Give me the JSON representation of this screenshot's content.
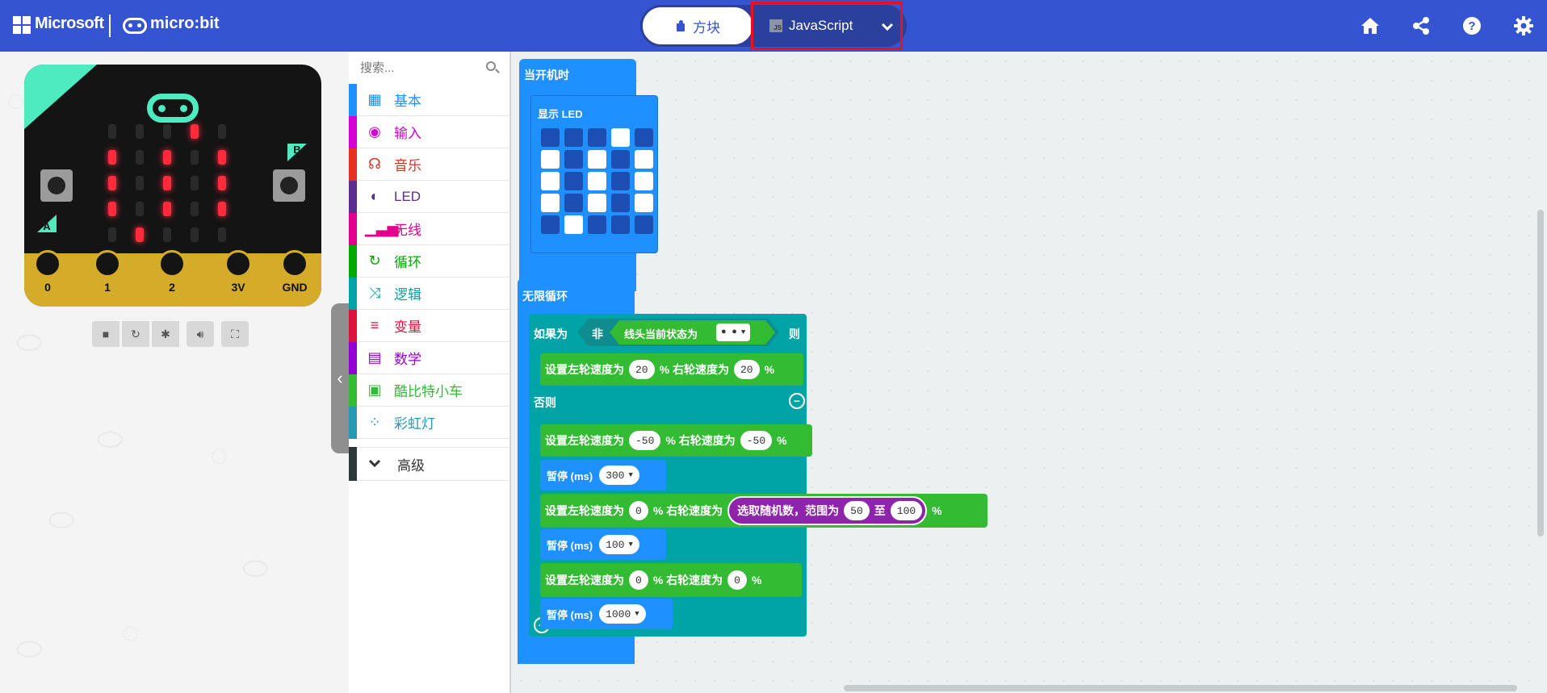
{
  "header": {
    "brand_microsoft": "Microsoft",
    "brand_microbit": "micro:bit",
    "mode_blocks_label": "方块",
    "mode_js_label": "JavaScript",
    "js_badge": "JS",
    "icons": [
      "home-icon",
      "share-icon",
      "help-icon",
      "settings-icon"
    ],
    "accent_color": "#3454d1"
  },
  "simulator": {
    "pins": [
      "0",
      "1",
      "2",
      "3V",
      "GND"
    ],
    "button_a": "A",
    "button_b": "B",
    "controls": [
      "stop-icon",
      "restart-icon",
      "debug-icon",
      "mute-icon",
      "fullscreen-icon"
    ]
  },
  "toolbox": {
    "search_placeholder": "搜索...",
    "categories": [
      {
        "label": "基本",
        "color": "#1e90ff",
        "icon": "grid-icon"
      },
      {
        "label": "输入",
        "color": "#d400d4",
        "icon": "target-icon"
      },
      {
        "label": "音乐",
        "color": "#e63022",
        "icon": "headphones-icon"
      },
      {
        "label": "LED",
        "color": "#5c2d91",
        "icon": "toggle-icon"
      },
      {
        "label": "无线",
        "color": "#e3008c",
        "icon": "signal-icon"
      },
      {
        "label": "循环",
        "color": "#00aa00",
        "icon": "refresh-icon"
      },
      {
        "label": "逻辑",
        "color": "#00a4a6",
        "icon": "shuffle-icon"
      },
      {
        "label": "变量",
        "color": "#dc143c",
        "icon": "list-icon"
      },
      {
        "label": "数学",
        "color": "#9400d3",
        "icon": "calculator-icon"
      },
      {
        "label": "酷比特小车",
        "color": "#33bb33",
        "icon": "bus-icon"
      },
      {
        "label": "彩虹灯",
        "color": "#2699b4",
        "icon": "dots-circle-icon"
      }
    ],
    "advanced_label": "高级"
  },
  "workspace": {
    "on_start": "当开机时",
    "show_leds": "显示 LED",
    "forever": "无限循环",
    "if_label": "如果为",
    "not_label": "非",
    "line_state": "线头当前状态为",
    "line_dots": "● ●",
    "then_label": "则",
    "else_label": "否则",
    "set_left": "设置左轮速度为",
    "set_right": "% 右轮速度为",
    "percent": "%",
    "pause": "暂停 (ms)",
    "random_label": "选取随机数，范围为",
    "to_label": "至",
    "values": {
      "speed1_left": "20",
      "speed1_right": "20",
      "speed2_left": "-50",
      "speed2_right": "-50",
      "pause1": "300",
      "speed3_left": "0",
      "rand_min": "50",
      "rand_max": "100",
      "pause2": "100",
      "speed4_left": "0",
      "speed4_right": "0",
      "pause3": "1000"
    }
  }
}
